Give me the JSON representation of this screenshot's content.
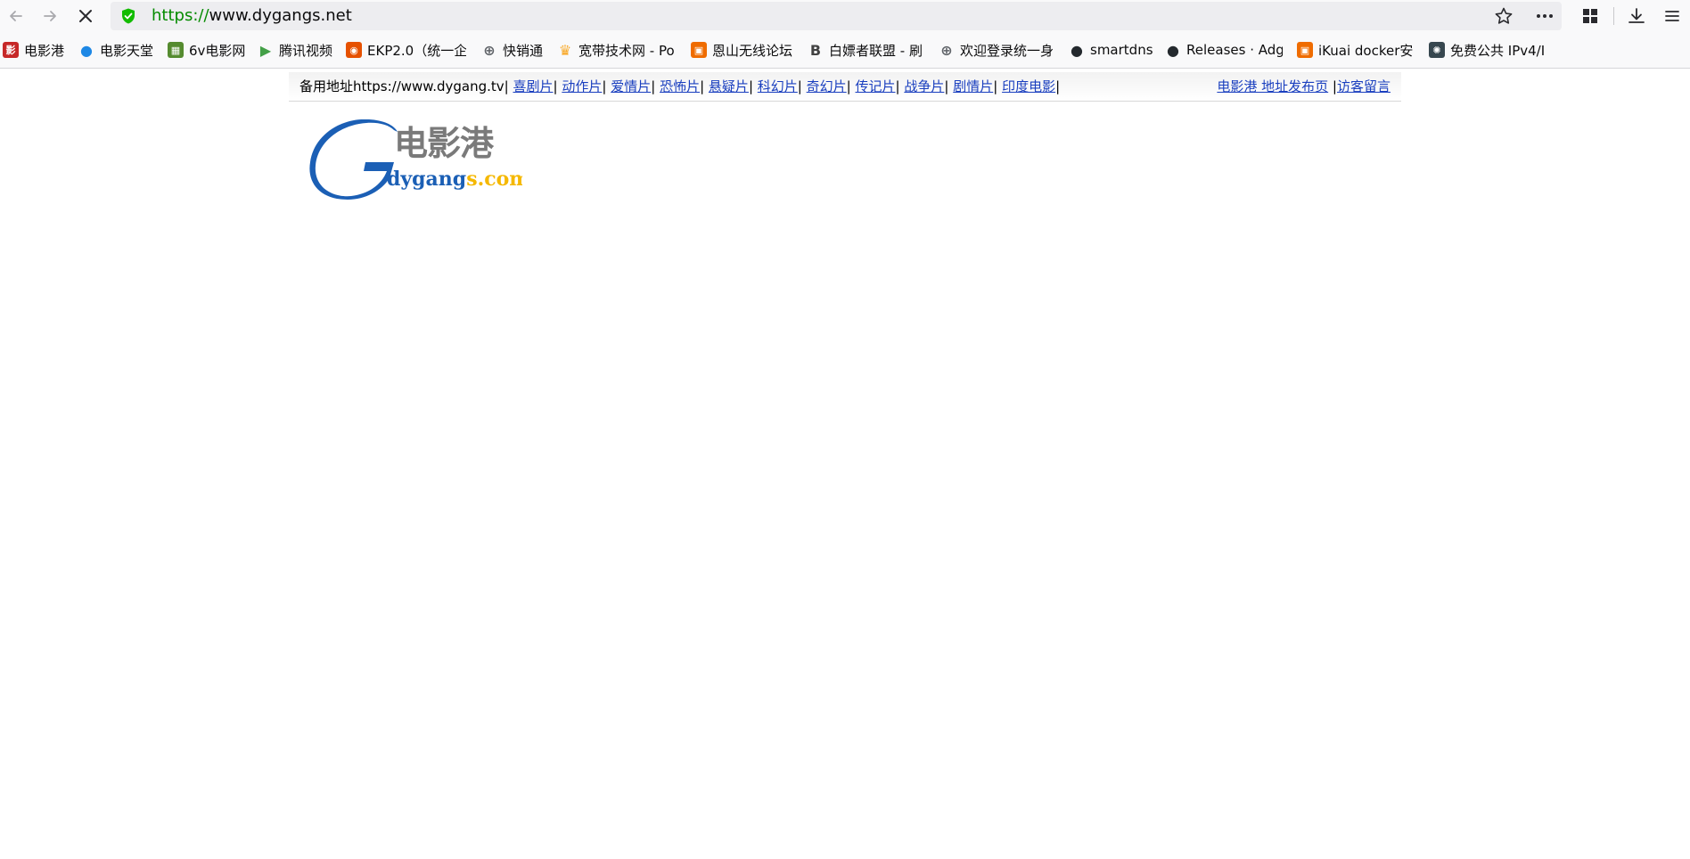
{
  "browser": {
    "url_scheme": "https://",
    "url_host": "www.dygangs.net",
    "bookmarks": [
      {
        "label": "电影港",
        "icon": "film-icon",
        "color": "#c62828"
      },
      {
        "label": "电影天堂",
        "icon": "circle-icon",
        "color": "#1e88e5"
      },
      {
        "label": "6v电影网",
        "icon": "grid-icon",
        "color": "#558b2f"
      },
      {
        "label": "腾讯视频",
        "icon": "play-icon",
        "color": "#43a047"
      },
      {
        "label": "EKP2.0（统一企",
        "icon": "badge-icon",
        "color": "#e65100"
      },
      {
        "label": "快销通",
        "icon": "globe-icon",
        "color": "#5f6368"
      },
      {
        "label": "宽带技术网 - Po",
        "icon": "trophy-icon",
        "color": "#f9a825"
      },
      {
        "label": "恩山无线论坛",
        "icon": "square-icon",
        "color": "#ef6c00"
      },
      {
        "label": "白嫖者联盟 - 刷",
        "icon": "letter-b-icon",
        "color": "#424242"
      },
      {
        "label": "欢迎登录统一身",
        "icon": "globe-icon",
        "color": "#5f6368"
      },
      {
        "label": "smartdns",
        "icon": "github-icon",
        "color": "#24292e"
      },
      {
        "label": "Releases · Adg",
        "icon": "github-icon",
        "color": "#24292e"
      },
      {
        "label": "iKuai docker安",
        "icon": "square-icon",
        "color": "#ef6c00"
      },
      {
        "label": "免费公共 IPv4/I",
        "icon": "gear-icon",
        "color": "#37474f"
      }
    ]
  },
  "site": {
    "backup_label": "备用地址https://www.dygang.tv",
    "categories": [
      "喜剧片",
      "动作片",
      "爱情片",
      "恐怖片",
      "悬疑片",
      "科幻片",
      "奇幻片",
      "传记片",
      "战争片",
      "剧情片",
      "印度电影"
    ],
    "right_links": [
      "电影港 地址发布页",
      "访客留言"
    ],
    "logo": {
      "brand_cn": "电影港",
      "brand_en_main": "dygang",
      "brand_en_tail": "s.com",
      "color_blue": "#1b5fb5",
      "color_gray": "#7a7a7a",
      "color_gold": "#f5b800"
    }
  }
}
